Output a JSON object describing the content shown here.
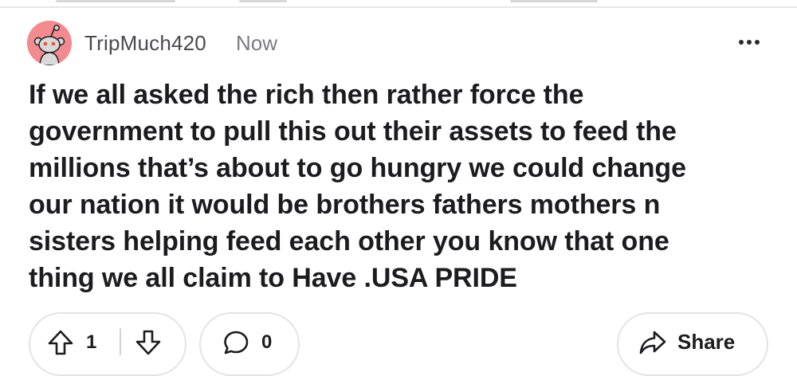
{
  "comment": {
    "author": "TripMuch420",
    "timestamp": "Now",
    "body_lines": [
      "If we all asked the rich then rather force the",
      "government to pull this out their assets to feed the",
      "millions that’s about to go hungry we could change",
      "our nation it would be brothers fathers mothers n",
      "sisters helping feed each other you know that one",
      "thing we all claim to Have .USA PRIDE"
    ]
  },
  "actions": {
    "vote_count": "1",
    "comment_count": "0",
    "share_label": "Share"
  },
  "icons": {
    "avatar": "snoo-avatar-icon",
    "more": "more-options-icon",
    "upvote": "upvote-arrow-icon",
    "downvote": "downvote-arrow-icon",
    "comment": "comment-bubble-icon",
    "share": "share-arrow-icon"
  },
  "colors": {
    "avatar_background": "#f28a8f",
    "text_primary": "#1c1c1e",
    "text_secondary": "#7c7c80",
    "pill_border": "#e3e3e3"
  }
}
